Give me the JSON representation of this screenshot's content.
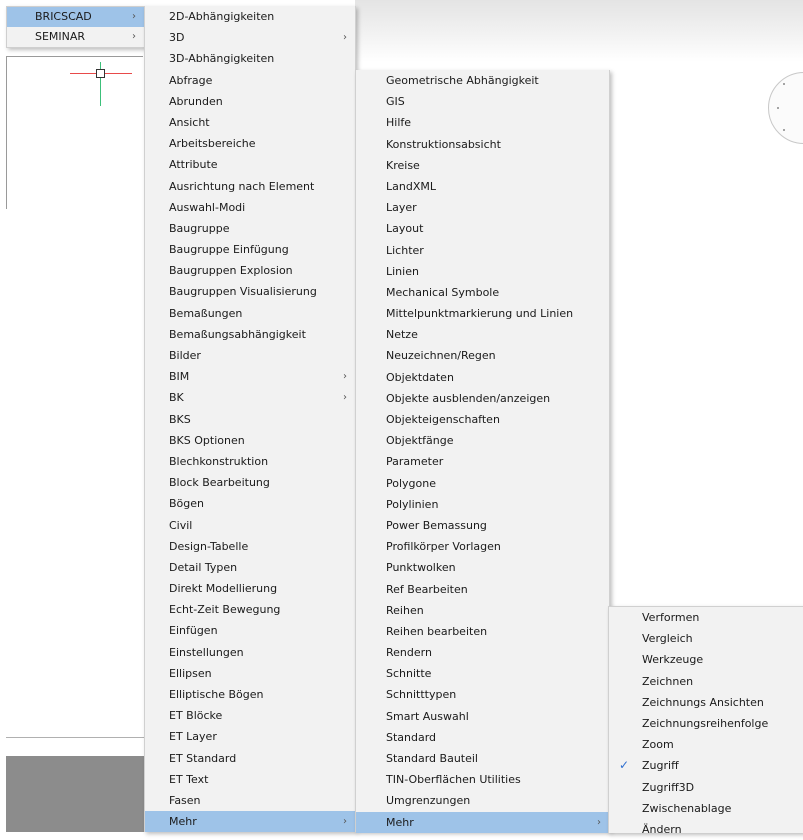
{
  "app_menu": [
    {
      "label": "BRICSCAD",
      "has_submenu": true,
      "highlighted": true
    },
    {
      "label": "SEMINAR",
      "has_submenu": true,
      "highlighted": false
    }
  ],
  "submenu_1": [
    {
      "label": "2D-Abhängigkeiten",
      "has_submenu": false
    },
    {
      "label": "3D",
      "has_submenu": true
    },
    {
      "label": "3D-Abhängigkeiten",
      "has_submenu": false
    },
    {
      "label": "Abfrage",
      "has_submenu": false
    },
    {
      "label": "Abrunden",
      "has_submenu": false
    },
    {
      "label": "Ansicht",
      "has_submenu": false
    },
    {
      "label": "Arbeitsbereiche",
      "has_submenu": false
    },
    {
      "label": "Attribute",
      "has_submenu": false
    },
    {
      "label": "Ausrichtung nach Element",
      "has_submenu": false
    },
    {
      "label": "Auswahl-Modi",
      "has_submenu": false
    },
    {
      "label": "Baugruppe",
      "has_submenu": false
    },
    {
      "label": "Baugruppe Einfügung",
      "has_submenu": false
    },
    {
      "label": "Baugruppen Explosion",
      "has_submenu": false
    },
    {
      "label": "Baugruppen Visualisierung",
      "has_submenu": false
    },
    {
      "label": "Bemaßungen",
      "has_submenu": false
    },
    {
      "label": "Bemaßungsabhängigkeit",
      "has_submenu": false
    },
    {
      "label": "Bilder",
      "has_submenu": false
    },
    {
      "label": "BIM",
      "has_submenu": true
    },
    {
      "label": "BK",
      "has_submenu": true
    },
    {
      "label": "BKS",
      "has_submenu": false
    },
    {
      "label": "BKS Optionen",
      "has_submenu": false
    },
    {
      "label": "Blechkonstruktion",
      "has_submenu": false
    },
    {
      "label": "Block Bearbeitung",
      "has_submenu": false
    },
    {
      "label": "Bögen",
      "has_submenu": false
    },
    {
      "label": "Civil",
      "has_submenu": false
    },
    {
      "label": "Design-Tabelle",
      "has_submenu": false
    },
    {
      "label": "Detail Typen",
      "has_submenu": false
    },
    {
      "label": "Direkt Modellierung",
      "has_submenu": false
    },
    {
      "label": "Echt-Zeit Bewegung",
      "has_submenu": false
    },
    {
      "label": "Einfügen",
      "has_submenu": false
    },
    {
      "label": "Einstellungen",
      "has_submenu": false
    },
    {
      "label": "Ellipsen",
      "has_submenu": false
    },
    {
      "label": "Elliptische Bögen",
      "has_submenu": false
    },
    {
      "label": "ET Blöcke",
      "has_submenu": false
    },
    {
      "label": "ET Layer",
      "has_submenu": false
    },
    {
      "label": "ET Standard",
      "has_submenu": false
    },
    {
      "label": "ET Text",
      "has_submenu": false
    },
    {
      "label": "Fasen",
      "has_submenu": false
    },
    {
      "label": "Mehr",
      "has_submenu": true,
      "highlighted": true
    }
  ],
  "submenu_2": [
    {
      "label": "Geometrische Abhängigkeit",
      "has_submenu": false
    },
    {
      "label": "GIS",
      "has_submenu": false
    },
    {
      "label": "Hilfe",
      "has_submenu": false
    },
    {
      "label": "Konstruktionsabsicht",
      "has_submenu": false
    },
    {
      "label": "Kreise",
      "has_submenu": false
    },
    {
      "label": "LandXML",
      "has_submenu": false
    },
    {
      "label": "Layer",
      "has_submenu": false
    },
    {
      "label": "Layout",
      "has_submenu": false
    },
    {
      "label": "Lichter",
      "has_submenu": false
    },
    {
      "label": "Linien",
      "has_submenu": false
    },
    {
      "label": "Mechanical Symbole",
      "has_submenu": false
    },
    {
      "label": "Mittelpunktmarkierung und Linien",
      "has_submenu": false
    },
    {
      "label": "Netze",
      "has_submenu": false
    },
    {
      "label": "Neuzeichnen/Regen",
      "has_submenu": false
    },
    {
      "label": "Objektdaten",
      "has_submenu": false
    },
    {
      "label": "Objekte ausblenden/anzeigen",
      "has_submenu": false
    },
    {
      "label": "Objekteigenschaften",
      "has_submenu": false
    },
    {
      "label": "Objektfänge",
      "has_submenu": false
    },
    {
      "label": "Parameter",
      "has_submenu": false
    },
    {
      "label": "Polygone",
      "has_submenu": false
    },
    {
      "label": "Polylinien",
      "has_submenu": false
    },
    {
      "label": "Power Bemassung",
      "has_submenu": false
    },
    {
      "label": "Profilkörper Vorlagen",
      "has_submenu": false
    },
    {
      "label": "Punktwolken",
      "has_submenu": false
    },
    {
      "label": "Ref Bearbeiten",
      "has_submenu": false
    },
    {
      "label": "Reihen",
      "has_submenu": false
    },
    {
      "label": "Reihen bearbeiten",
      "has_submenu": false
    },
    {
      "label": "Rendern",
      "has_submenu": false
    },
    {
      "label": "Schnitte",
      "has_submenu": false
    },
    {
      "label": "Schnitttypen",
      "has_submenu": false
    },
    {
      "label": "Smart Auswahl",
      "has_submenu": false
    },
    {
      "label": "Standard",
      "has_submenu": false
    },
    {
      "label": "Standard Bauteil",
      "has_submenu": false
    },
    {
      "label": "TIN-Oberflächen Utilities",
      "has_submenu": false
    },
    {
      "label": "Umgrenzungen",
      "has_submenu": false
    },
    {
      "label": "Mehr",
      "has_submenu": true,
      "highlighted": true
    }
  ],
  "submenu_3": [
    {
      "label": "Verformen",
      "checked": false
    },
    {
      "label": "Vergleich",
      "checked": false
    },
    {
      "label": "Werkzeuge",
      "checked": false
    },
    {
      "label": "Zeichnen",
      "checked": false
    },
    {
      "label": "Zeichnungs Ansichten",
      "checked": false
    },
    {
      "label": "Zeichnungsreihenfolge",
      "checked": false
    },
    {
      "label": "Zoom",
      "checked": false
    },
    {
      "label": "Zugriff",
      "checked": true
    },
    {
      "label": "Zugriff3D",
      "checked": false
    },
    {
      "label": "Zwischenablage",
      "checked": false
    },
    {
      "label": "Ändern",
      "checked": false
    }
  ],
  "icons": {
    "submenu_arrow": "chevron-right-icon",
    "check": "check-icon"
  },
  "colors": {
    "menu_bg": "#f2f2f2",
    "highlight": "#9ec3e8",
    "check": "#2f6fd0"
  }
}
